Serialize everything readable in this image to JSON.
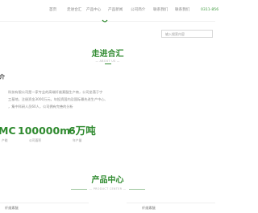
{
  "nav": {
    "items": [
      "首页",
      "走进合汇",
      "产品中心",
      "产品新闻",
      "公司简介",
      "联系我们",
      "联系我们"
    ],
    "phone": "0311-856"
  },
  "search": {
    "placeholder": "输入搜索内容"
  },
  "about": {
    "title": "走进合汇",
    "subtitle": "— ABOUT US —",
    "intro_heading": "介",
    "intro_lines": [
      "科技有限公司是一家专业的高端纤维素醚生产商，公司坐落于宁",
      "工基地，注册资金3000万元，年投资国内及国际最先进生产中心、",
      "，集中科研人员60人，公司拥有完善的分析"
    ]
  },
  "stats": [
    {
      "value": "MC",
      "label": "产能"
    },
    {
      "value": "100000m²",
      "label": "公司面积"
    },
    {
      "value": "6万吨",
      "label": "年产量"
    }
  ],
  "products": {
    "title": "产品中心",
    "subtitle": "— PRODUCT CENTER —",
    "categories": [
      "纤维素醚",
      "纤维素醚"
    ]
  },
  "colors": {
    "accent": "#2f8a2f",
    "muted": "#8a8a8a"
  }
}
